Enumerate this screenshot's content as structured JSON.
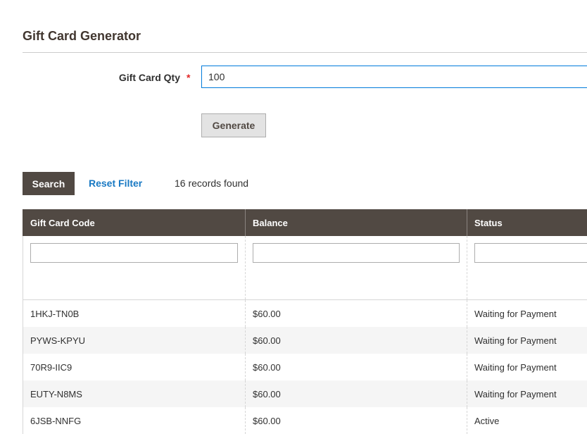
{
  "generator": {
    "title": "Gift Card Generator",
    "qty_label": "Gift Card Qty",
    "required_mark": "*",
    "qty_value": "100",
    "generate_label": "Generate"
  },
  "grid_toolbar": {
    "search_label": "Search",
    "reset_label": "Reset Filter",
    "records_found": "16 records found"
  },
  "table": {
    "columns": [
      "Gift Card Code",
      "Balance",
      "Status"
    ],
    "rows": [
      {
        "code": "1HKJ-TN0B",
        "balance": "$60.00",
        "status": "Waiting for Payment"
      },
      {
        "code": "PYWS-KPYU",
        "balance": "$60.00",
        "status": "Waiting for Payment"
      },
      {
        "code": "70R9-IIC9",
        "balance": "$60.00",
        "status": "Waiting for Payment"
      },
      {
        "code": "EUTY-N8MS",
        "balance": "$60.00",
        "status": "Waiting for Payment"
      },
      {
        "code": "6JSB-NNFG",
        "balance": "$60.00",
        "status": "Active"
      }
    ]
  },
  "colors": {
    "header_bg": "#514943",
    "link": "#1979c3",
    "required": "#e22626",
    "input_focus_border": "#007bdb"
  }
}
